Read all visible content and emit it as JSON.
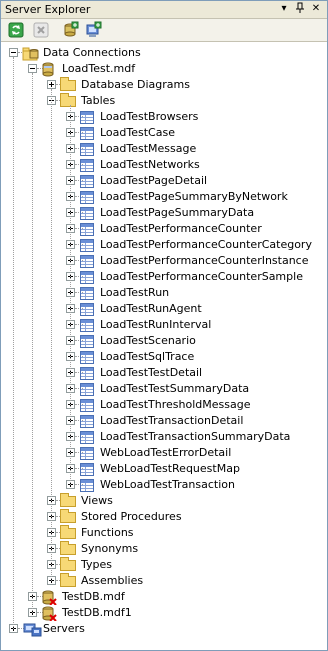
{
  "window": {
    "title": "Server Explorer",
    "controls": [
      "▾",
      "ᵖ",
      "×"
    ]
  },
  "toolbar": {
    "buttons": [
      "refresh-icon",
      "stop-icon",
      "connect-database-icon",
      "connect-server-icon"
    ]
  },
  "tree": {
    "data_connections": "Data Connections",
    "loadtest_db": "LoadTest.mdf",
    "folders_top": [
      "Database Diagrams",
      "Tables"
    ],
    "tables": [
      "LoadTestBrowsers",
      "LoadTestCase",
      "LoadTestMessage",
      "LoadTestNetworks",
      "LoadTestPageDetail",
      "LoadTestPageSummaryByNetwork",
      "LoadTestPageSummaryData",
      "LoadTestPerformanceCounter",
      "LoadTestPerformanceCounterCategory",
      "LoadTestPerformanceCounterInstance",
      "LoadTestPerformanceCounterSample",
      "LoadTestRun",
      "LoadTestRunAgent",
      "LoadTestRunInterval",
      "LoadTestScenario",
      "LoadTestSqlTrace",
      "LoadTestTestDetail",
      "LoadTestTestSummaryData",
      "LoadTestThresholdMessage",
      "LoadTestTransactionDetail",
      "LoadTestTransactionSummaryData",
      "WebLoadTestErrorDetail",
      "WebLoadTestRequestMap",
      "WebLoadTestTransaction"
    ],
    "folders_bottom": [
      "Views",
      "Stored Procedures",
      "Functions",
      "Synonyms",
      "Types",
      "Assemblies"
    ],
    "other_dbs": [
      "TestDB.mdf",
      "TestDB.mdf1"
    ],
    "servers": "Servers"
  }
}
